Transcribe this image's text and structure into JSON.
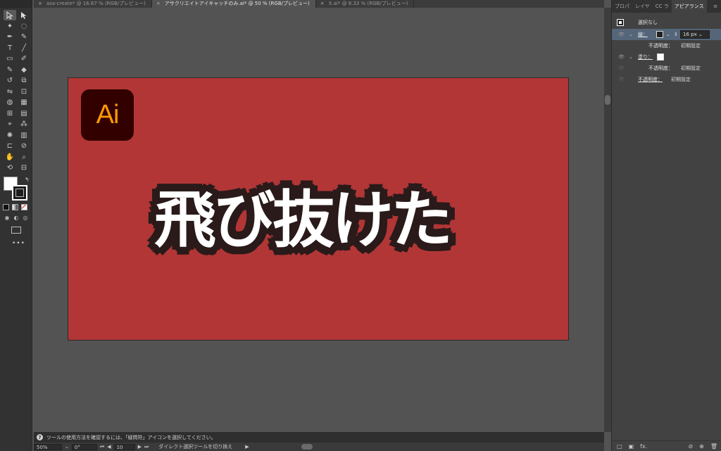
{
  "tabs": [
    {
      "label": "asa-create* @ 16.67 % (RGB/プレビュー)",
      "active": false
    },
    {
      "label": "アサクリエイトアイキャッチのみ.ai* @ 50 % (RGB/プレビュー)",
      "active": true
    },
    {
      "label": "X.ai* @ 8.33 % (RGB/プレビュー)",
      "active": false
    }
  ],
  "artboard": {
    "logo_text": "Ai",
    "headline": "飛び抜けた",
    "background_color": "#b23636",
    "logo_color": "#ff9a00",
    "logo_bg": "#330000"
  },
  "status": {
    "help_text": "ツールの使用方法を確認するには、「疑問符」アイコンを選択してください。"
  },
  "bottom": {
    "zoom": "50%",
    "rotation": "0°",
    "artboard_num": "10",
    "tool_hint": "ダイレクト選択ツールを切り換え"
  },
  "panel": {
    "tabs": [
      "プロパ",
      "レイヤ",
      "CC ラ",
      "アピアランス"
    ],
    "active_tab": "アピアランス",
    "selection": "選択なし",
    "stroke_label": "線：",
    "stroke_weight": "16 px",
    "opacity_label": "不透明度：",
    "opacity_value": "初期設定",
    "fill_label": "塗り：",
    "fx_label": "fx."
  }
}
